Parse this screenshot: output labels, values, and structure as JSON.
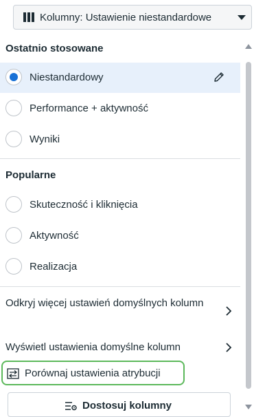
{
  "columns_button": {
    "label": "Kolumny: Ustawienie niestandardowe",
    "icon": "columns-icon",
    "caret_icon": "caret-down-icon"
  },
  "recent": {
    "title": "Ostatnio stosowane",
    "items": [
      {
        "label": "Niestandardowy",
        "selected": true,
        "edit_icon": "pencil-icon"
      },
      {
        "label": "Performance + aktywność",
        "selected": false
      },
      {
        "label": "Wyniki",
        "selected": false
      }
    ]
  },
  "popular": {
    "title": "Popularne",
    "items": [
      {
        "label": "Skuteczność i kliknięcia",
        "selected": false
      },
      {
        "label": "Aktywność",
        "selected": false
      },
      {
        "label": "Realizacja",
        "selected": false
      }
    ]
  },
  "links": [
    {
      "label": "Odkryj więcej ustawień domyślnych kolumn",
      "icon": "chevron-right-icon"
    },
    {
      "label": "Wyświetl ustawienia domyślne kolumn",
      "icon": "chevron-right-icon"
    }
  ],
  "compare_attribution": {
    "label": "Porównaj ustawienia atrybucji",
    "icon": "compare-icon",
    "highlight_color": "#5bb85a"
  },
  "customize": {
    "label": "Dostosuj kolumny",
    "icon": "customize-columns-icon"
  },
  "colors": {
    "accent": "#1a72d6",
    "selected_bg": "#e7f0fb",
    "text": "#1c2b33"
  }
}
